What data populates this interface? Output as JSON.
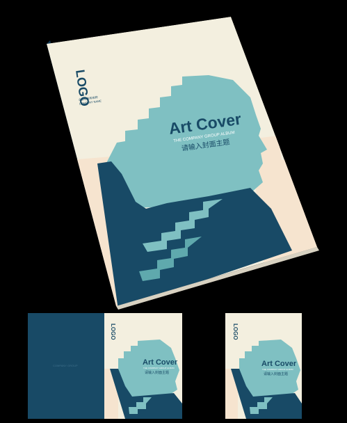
{
  "colors": {
    "background": "#000000",
    "paper": "#f3efdf",
    "peach": "#f6e4cf",
    "teal": "#7fc0c2",
    "teal_dark": "#5fa9ad",
    "navy": "#184a66",
    "navy_dark": "#0f3550"
  },
  "main_cover": {
    "logo_text": "LOGO",
    "logo_caption_1": "企业标志和名称",
    "logo_caption_2": "COMPANY NAME",
    "title": "Art Cover",
    "subtitle": "THE COMPANY GROUP ALBUM",
    "chinese_tagline": "请输入封面主题"
  },
  "spread_preview": {
    "back_caption": "COMPANY GROUP",
    "logo_text": "LOGO",
    "title": "Art Cover",
    "subtitle": "THE COMPANY GROUP ALBUM",
    "chinese_tagline": "请输入封面主题"
  },
  "front_preview": {
    "logo_text": "LOGO",
    "title": "Art Cover",
    "subtitle": "THE COMPANY GROUP ALBUM",
    "chinese_tagline": "请输入封面主题"
  }
}
